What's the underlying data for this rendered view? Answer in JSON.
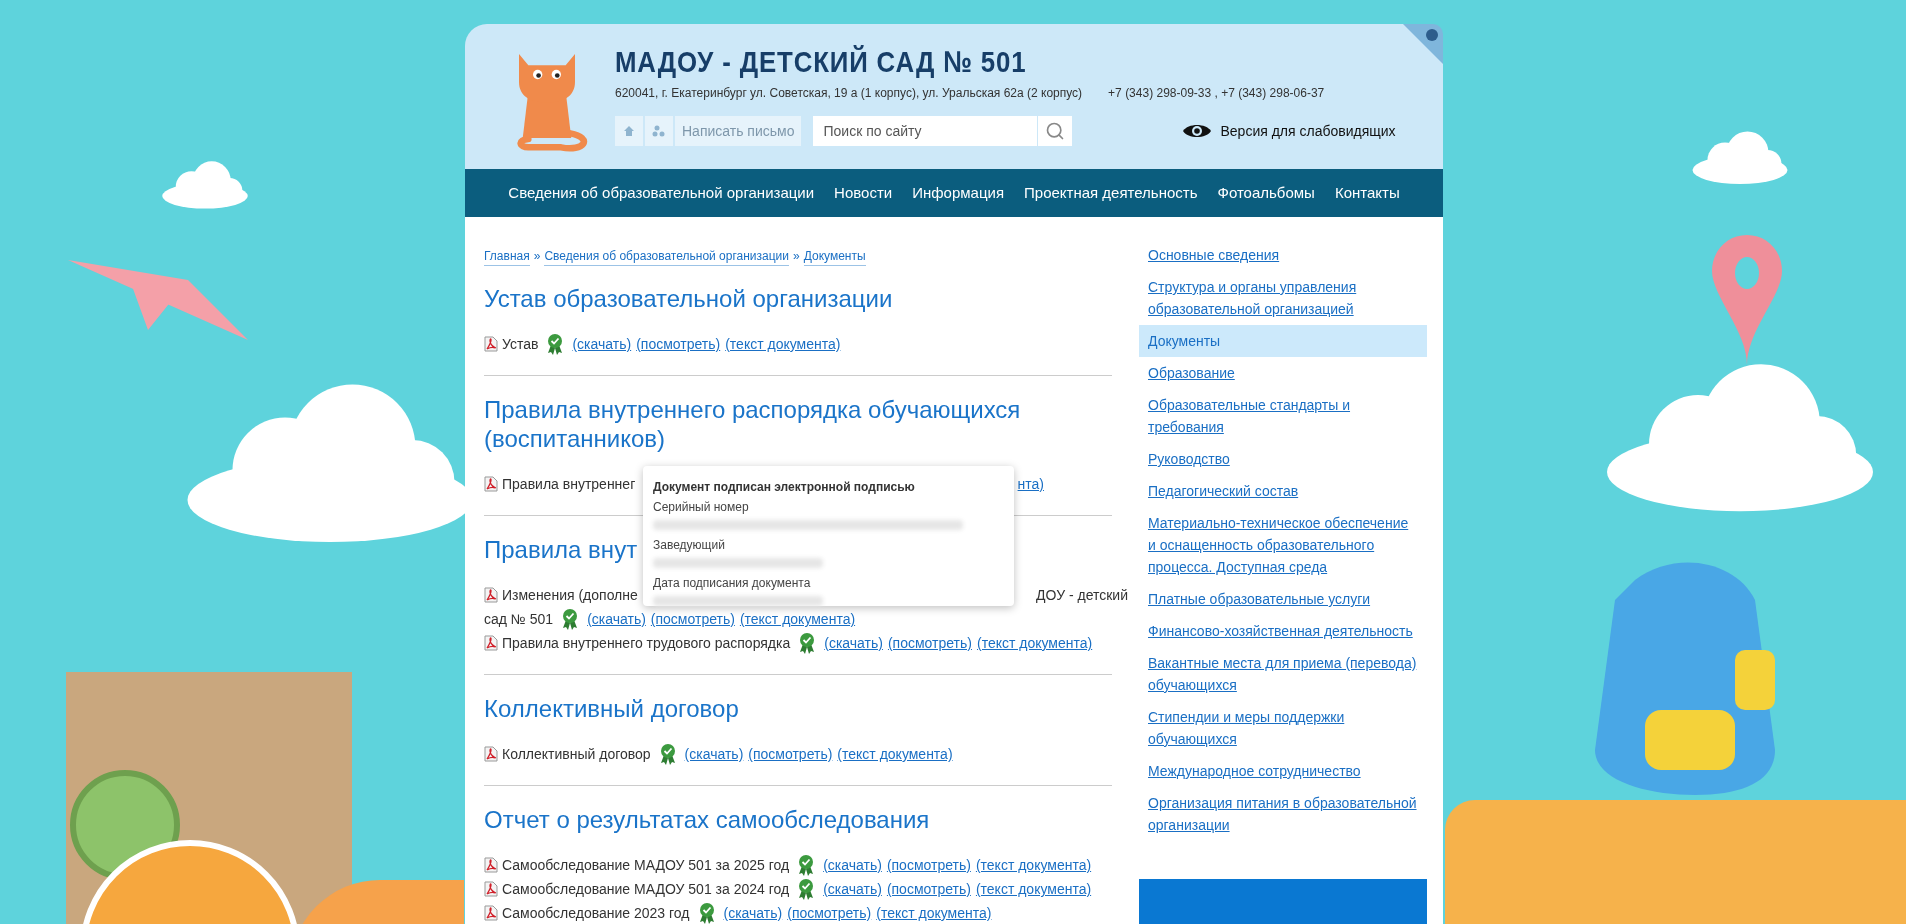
{
  "header": {
    "title": "МАДОУ - ДЕТСКИЙ САД № 501",
    "address": "620041, г. Екатеринбург ул. Советская, 19 а (1 корпус), ул. Уральская 62а (2 корпус)",
    "phones": "+7 (343) 298-09-33 , +7 (343) 298-06-37",
    "write_button": "Написать письмо",
    "search": {
      "placeholder": "Поиск по сайту"
    },
    "accessibility_link": "Версия для слабовидящих"
  },
  "nav": [
    "Сведения об образовательной организации",
    "Новости",
    "Информация",
    "Проектная деятельность",
    "Фотоальбомы",
    "Контакты"
  ],
  "breadcrumbs": {
    "items": [
      "Главная",
      "Сведения об образовательной организации",
      "Документы"
    ],
    "separator": "»"
  },
  "sections": [
    {
      "title": "Устав образовательной организации",
      "documents": [
        {
          "kind": "full",
          "name": "Устав",
          "signed": true,
          "links": [
            "(скачать)",
            "(посмотреть)",
            "(текст документа)"
          ]
        }
      ]
    },
    {
      "title": "Правила внутреннего распорядка обучающихся (воспитанников)",
      "documents": [
        {
          "kind": "covered",
          "before": "Правила внутреннег",
          "after": "нта)"
        }
      ]
    },
    {
      "title": "Правила внут",
      "documents": [
        {
          "kind": "covered",
          "before": "Изменения (дополне",
          "after": "ДОУ - детский",
          "next_line": "сад № 501",
          "signed": true,
          "links": [
            "(скачать)",
            "(посмотреть)",
            "(текст документа)"
          ]
        },
        {
          "kind": "full",
          "name": "Правила внутреннего трудового распорядка",
          "signed": true,
          "links": [
            "(скачать)",
            "(посмотреть)",
            "(текст документа)"
          ]
        }
      ]
    },
    {
      "title": "Коллективный договор",
      "documents": [
        {
          "kind": "full",
          "name": "Коллективный договор",
          "signed": true,
          "links": [
            "(скачать)",
            "(посмотреть)",
            "(текст документа)"
          ]
        }
      ]
    },
    {
      "title": "Отчет о результатах самообследования",
      "documents": [
        {
          "kind": "full",
          "name": "Самообследование МАДОУ 501 за 2025 год",
          "signed": true,
          "links": [
            "(скачать)",
            "(посмотреть)",
            "(текст документа)"
          ]
        },
        {
          "kind": "full",
          "name": "Самообследование МАДОУ 501 за 2024 год",
          "signed": true,
          "links": [
            "(скачать)",
            "(посмотреть)",
            "(текст документа)"
          ]
        },
        {
          "kind": "full",
          "name": "Самообследование 2023 год",
          "signed": true,
          "links": [
            "(скачать)",
            "(посмотреть)",
            "(текст документа)"
          ]
        }
      ]
    }
  ],
  "signature_popup": {
    "title": "Документ подписан электронной подписью",
    "fields": [
      "Серийный номер",
      "Заведующий",
      "Дата подписания документа"
    ]
  },
  "sidebar": [
    {
      "label": "Основные сведения",
      "selected": false
    },
    {
      "label": "Структура и органы управления образовательной организацией",
      "selected": false
    },
    {
      "label": "Документы",
      "selected": true
    },
    {
      "label": "Образование",
      "selected": false
    },
    {
      "label": "Образовательные стандарты и требования",
      "selected": false
    },
    {
      "label": "Руководство",
      "selected": false
    },
    {
      "label": "Педагогический состав",
      "selected": false
    },
    {
      "label": "Материально-техническое обеспечение и оснащенность образовательного процесса. Доступная среда",
      "selected": false
    },
    {
      "label": "Платные образовательные услуги",
      "selected": false
    },
    {
      "label": "Финансово-хозяйственная деятельность",
      "selected": false
    },
    {
      "label": "Вакантные места для приема (перевода) обучающихся",
      "selected": false
    },
    {
      "label": "Стипендии и меры поддержки обучающихся",
      "selected": false
    },
    {
      "label": "Международное сотрудничество",
      "selected": false
    },
    {
      "label": "Организация питания в образовательной организации",
      "selected": false
    }
  ]
}
